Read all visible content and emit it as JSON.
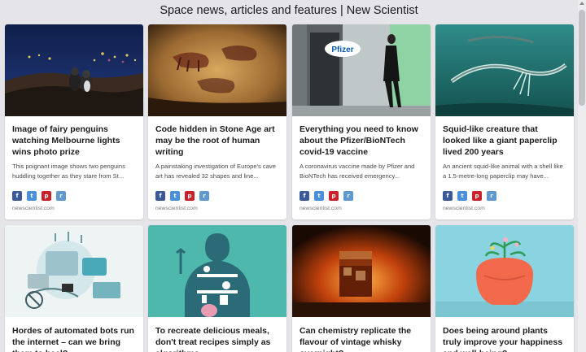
{
  "page": {
    "title": "Space news, articles and features | New Scientist"
  },
  "cards": [
    {
      "headline": "Image of fairy penguins watching Melbourne lights wins photo prize",
      "excerpt": "This poignant image shows two penguins huddling together as they stare from St...",
      "source": "newscientist.com",
      "image": "penguins-city-lights-photo"
    },
    {
      "headline": "Code hidden in Stone Age art may be the root of human writing",
      "excerpt": "A painstaking investigation of Europe's cave art has revealed 32 shapes and line...",
      "source": "newscientist.com",
      "image": "cave-painting-photo"
    },
    {
      "headline": "Everything you need to know about the Pfizer/BioNTech covid-19 vaccine",
      "excerpt": "A coronavirus vaccine made by Pfizer and BioNTech has received emergency...",
      "source": "newscientist.com",
      "image": "pfizer-building-photo",
      "logo_text": "Pfizer"
    },
    {
      "headline": "Squid-like creature that looked like a giant paperclip lived 200 years",
      "excerpt": "An ancient squid-like animal with a shell like a 1.5-metre-long paperclip may have...",
      "source": "newscientist.com",
      "image": "ancient-squid-illustration"
    },
    {
      "headline": "Hordes of automated bots run the internet – can we bring them to heel?",
      "image": "automated-bots-illustration"
    },
    {
      "headline": "To recreate delicious meals, don't treat recipes simply as algorithms",
      "image": "kitchen-silhouette-illustration"
    },
    {
      "headline": "Can chemistry replicate the flavour of vintage whisky overnight?",
      "image": "whisky-glass-photo"
    },
    {
      "headline": "Does being around plants truly improve your happiness and well-being?",
      "image": "plants-head-illustration"
    }
  ],
  "share_icons": [
    "facebook-icon",
    "twitter-icon",
    "pinterest-icon",
    "reddit-icon"
  ],
  "share_glyphs": {
    "facebook": "f",
    "twitter": "t",
    "pinterest": "p",
    "reddit": "r"
  }
}
